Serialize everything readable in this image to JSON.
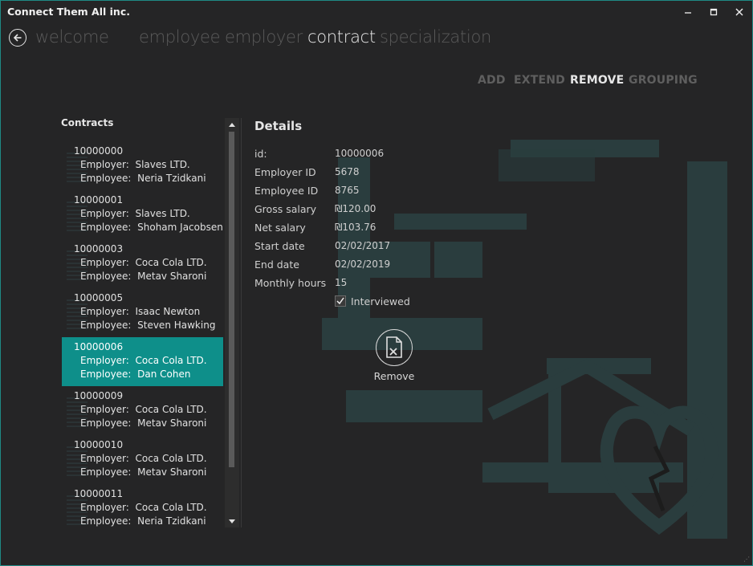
{
  "window": {
    "title": "Connect Them All inc."
  },
  "nav": {
    "items": [
      {
        "label": "welcome"
      },
      {
        "label": "employee"
      },
      {
        "label": "employer"
      },
      {
        "label": "contract"
      },
      {
        "label": "specialization"
      }
    ],
    "active": "contract"
  },
  "subnav": {
    "items": [
      {
        "label": "ADD"
      },
      {
        "label": "EXTEND"
      },
      {
        "label": "REMOVE"
      },
      {
        "label": "GROUPING"
      }
    ],
    "active": "REMOVE"
  },
  "contracts": {
    "header": "Contracts",
    "employer_prefix": "Employer:",
    "employee_prefix": "Employee:",
    "items": [
      {
        "id": "10000000",
        "employer": "Slaves LTD.",
        "employee": "Neria Tzidkani"
      },
      {
        "id": "10000001",
        "employer": "Slaves LTD.",
        "employee": "Shoham Jacobsen"
      },
      {
        "id": "10000003",
        "employer": "Coca Cola LTD.",
        "employee": "Metav Sharoni"
      },
      {
        "id": "10000005",
        "employer": "Isaac Newton",
        "employee": "Steven Hawking"
      },
      {
        "id": "10000006",
        "employer": "Coca Cola LTD.",
        "employee": "Dan Cohen"
      },
      {
        "id": "10000009",
        "employer": "Coca Cola LTD.",
        "employee": "Metav Sharoni"
      },
      {
        "id": "10000010",
        "employer": "Coca Cola LTD.",
        "employee": "Metav Sharoni"
      },
      {
        "id": "10000011",
        "employer": "Coca Cola LTD.",
        "employee": "Neria Tzidkani"
      }
    ],
    "selected_index": 4
  },
  "details": {
    "title": "Details",
    "fields": [
      {
        "label": "id:",
        "value": "10000006"
      },
      {
        "label": "Employer ID",
        "value": "5678"
      },
      {
        "label": "Employee ID",
        "value": "8765"
      },
      {
        "label": "Gross salary",
        "value": "₪120.00"
      },
      {
        "label": "Net salary",
        "value": "₪103.76"
      },
      {
        "label": "Start date",
        "value": "02/02/2017"
      },
      {
        "label": "End date",
        "value": "02/02/2019"
      },
      {
        "label": "Monthly hours",
        "value": "15"
      }
    ],
    "interviewed": {
      "label": "Interviewed",
      "checked": true
    },
    "remove_button": {
      "label": "Remove",
      "icon": "remove-document-icon"
    }
  },
  "colors": {
    "accent": "#0e8f8a",
    "background": "#252526",
    "border": "#1f8a85"
  }
}
